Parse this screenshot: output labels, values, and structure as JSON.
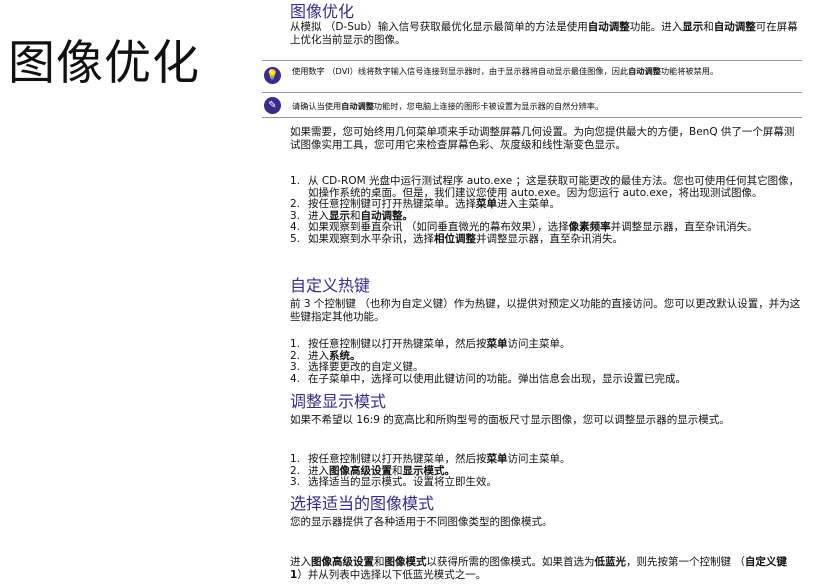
{
  "side_title": "图像优化",
  "sections": [
    {
      "heading": "图像优化",
      "intro": [
        {
          "t": "从模拟 （D-Sub）输入信号获取最优化显示最简单的方法是使用",
          "b": false
        },
        {
          "t": "自动调整",
          "b": true
        },
        {
          "t": "功能。进入",
          "b": false
        },
        {
          "t": "显示",
          "b": true
        },
        {
          "t": "和",
          "b": false
        },
        {
          "t": "自动调整",
          "b": true
        },
        {
          "t": "可在屏幕上优化当前显示的图像。",
          "b": false
        }
      ]
    }
  ],
  "notes": [
    {
      "icon": "lightbulb-icon",
      "glyph": "💡",
      "segments": [
        {
          "t": "使用数字 （DVI）线将数字输入信号连接到显示器时，由于显示器将自动显示最佳图像，因此",
          "b": false
        },
        {
          "t": "自动调整",
          "b": true
        },
        {
          "t": "功能将被禁用。",
          "b": false
        }
      ]
    },
    {
      "icon": "pencil-icon",
      "glyph": "✎",
      "segments": [
        {
          "t": "请确认当使用",
          "b": false
        },
        {
          "t": "自动调整",
          "b": true
        },
        {
          "t": "功能时，您电脑上连接的图形卡被设置为显示器的自然分辨率。",
          "b": false
        }
      ]
    }
  ],
  "manual_para": "如果需要，您可始终用几何菜单项来手动调整屏幕几何设置。为向您提供最大的方便，BenQ 供了一个屏幕测试图像实用工具，您可用它来检查屏幕色彩、灰度级和线性渐变色显示。",
  "steps1": [
    [
      {
        "t": "从 CD-ROM 光盘中运行测试程序 auto.exe ；这是获取可能更改的最佳方法。您也可使用任何其它图像，如操作系统的桌面。但是，我们建议您使用 auto.exe。因为您运行 auto.exe，将出现测试图像。",
        "b": false
      }
    ],
    [
      {
        "t": "按任意控制键可打开热键菜单。选择",
        "b": false
      },
      {
        "t": "菜单",
        "b": true
      },
      {
        "t": "进入主菜单。",
        "b": false
      }
    ],
    [
      {
        "t": "进入",
        "b": false
      },
      {
        "t": "显示",
        "b": true
      },
      {
        "t": "和",
        "b": false
      },
      {
        "t": "自动调整。",
        "b": true
      }
    ],
    [
      {
        "t": "如果观察到垂直杂讯 （如同垂直微光的幕布效果），选择",
        "b": false
      },
      {
        "t": "像素频率",
        "b": true
      },
      {
        "t": "并调整显示器，直至杂讯消失。",
        "b": false
      }
    ],
    [
      {
        "t": "如果观察到水平杂讯，选择",
        "b": false
      },
      {
        "t": "相位调整",
        "b": true
      },
      {
        "t": "并调整显示器，直至杂讯消失。",
        "b": false
      }
    ]
  ],
  "hotkey": {
    "heading": "自定义热键",
    "para": "前 3 个控制键 （也称为自定义键）作为热键，以提供对预定义功能的直接访问。您可以更改默认设置，并为这些键指定其他功能。",
    "steps": [
      [
        {
          "t": "按任意控制键以打开热键菜单，然后按",
          "b": false
        },
        {
          "t": "菜单",
          "b": true
        },
        {
          "t": "访问主菜单。",
          "b": false
        }
      ],
      [
        {
          "t": "进入",
          "b": false
        },
        {
          "t": "系统。",
          "b": true
        }
      ],
      [
        {
          "t": "选择要更改的自定义键。",
          "b": false
        }
      ],
      [
        {
          "t": "在子菜单中，选择可以使用此键访问的功能。弹出信息会出现，显示设置已完成。",
          "b": false
        }
      ]
    ]
  },
  "display_mode": {
    "heading": "调整显示模式",
    "para": "如果不希望以 16:9 的宽高比和所购型号的面板尺寸显示图像，您可以调整显示器的显示模式。",
    "steps": [
      [
        {
          "t": "按任意控制键以打开热键菜单，然后按",
          "b": false
        },
        {
          "t": "菜单",
          "b": true
        },
        {
          "t": "访问主菜单。",
          "b": false
        }
      ],
      [
        {
          "t": "进入",
          "b": false
        },
        {
          "t": "图像高级设置",
          "b": true
        },
        {
          "t": "和",
          "b": false
        },
        {
          "t": "显示模式。",
          "b": true
        }
      ],
      [
        {
          "t": "选择适当的显示模式。设置将立即生效。",
          "b": false
        }
      ]
    ]
  },
  "picture_mode": {
    "heading": "选择适当的图像模式",
    "para": "您的显示器提供了各种适用于不同图像类型的图像模式。",
    "para2": [
      {
        "t": "进入",
        "b": false
      },
      {
        "t": "图像高级设置",
        "b": true
      },
      {
        "t": "和",
        "b": false
      },
      {
        "t": "图像模式",
        "b": true
      },
      {
        "t": "以获得所需的图像模式。如果首选为",
        "b": false
      },
      {
        "t": "低蓝光",
        "b": true
      },
      {
        "t": "，则先按第一个控制键 （",
        "b": false
      },
      {
        "t": "自定义键 1",
        "b": true
      },
      {
        "t": "）并从列表中选择以下低蓝光模式之一。",
        "b": false
      }
    ]
  }
}
